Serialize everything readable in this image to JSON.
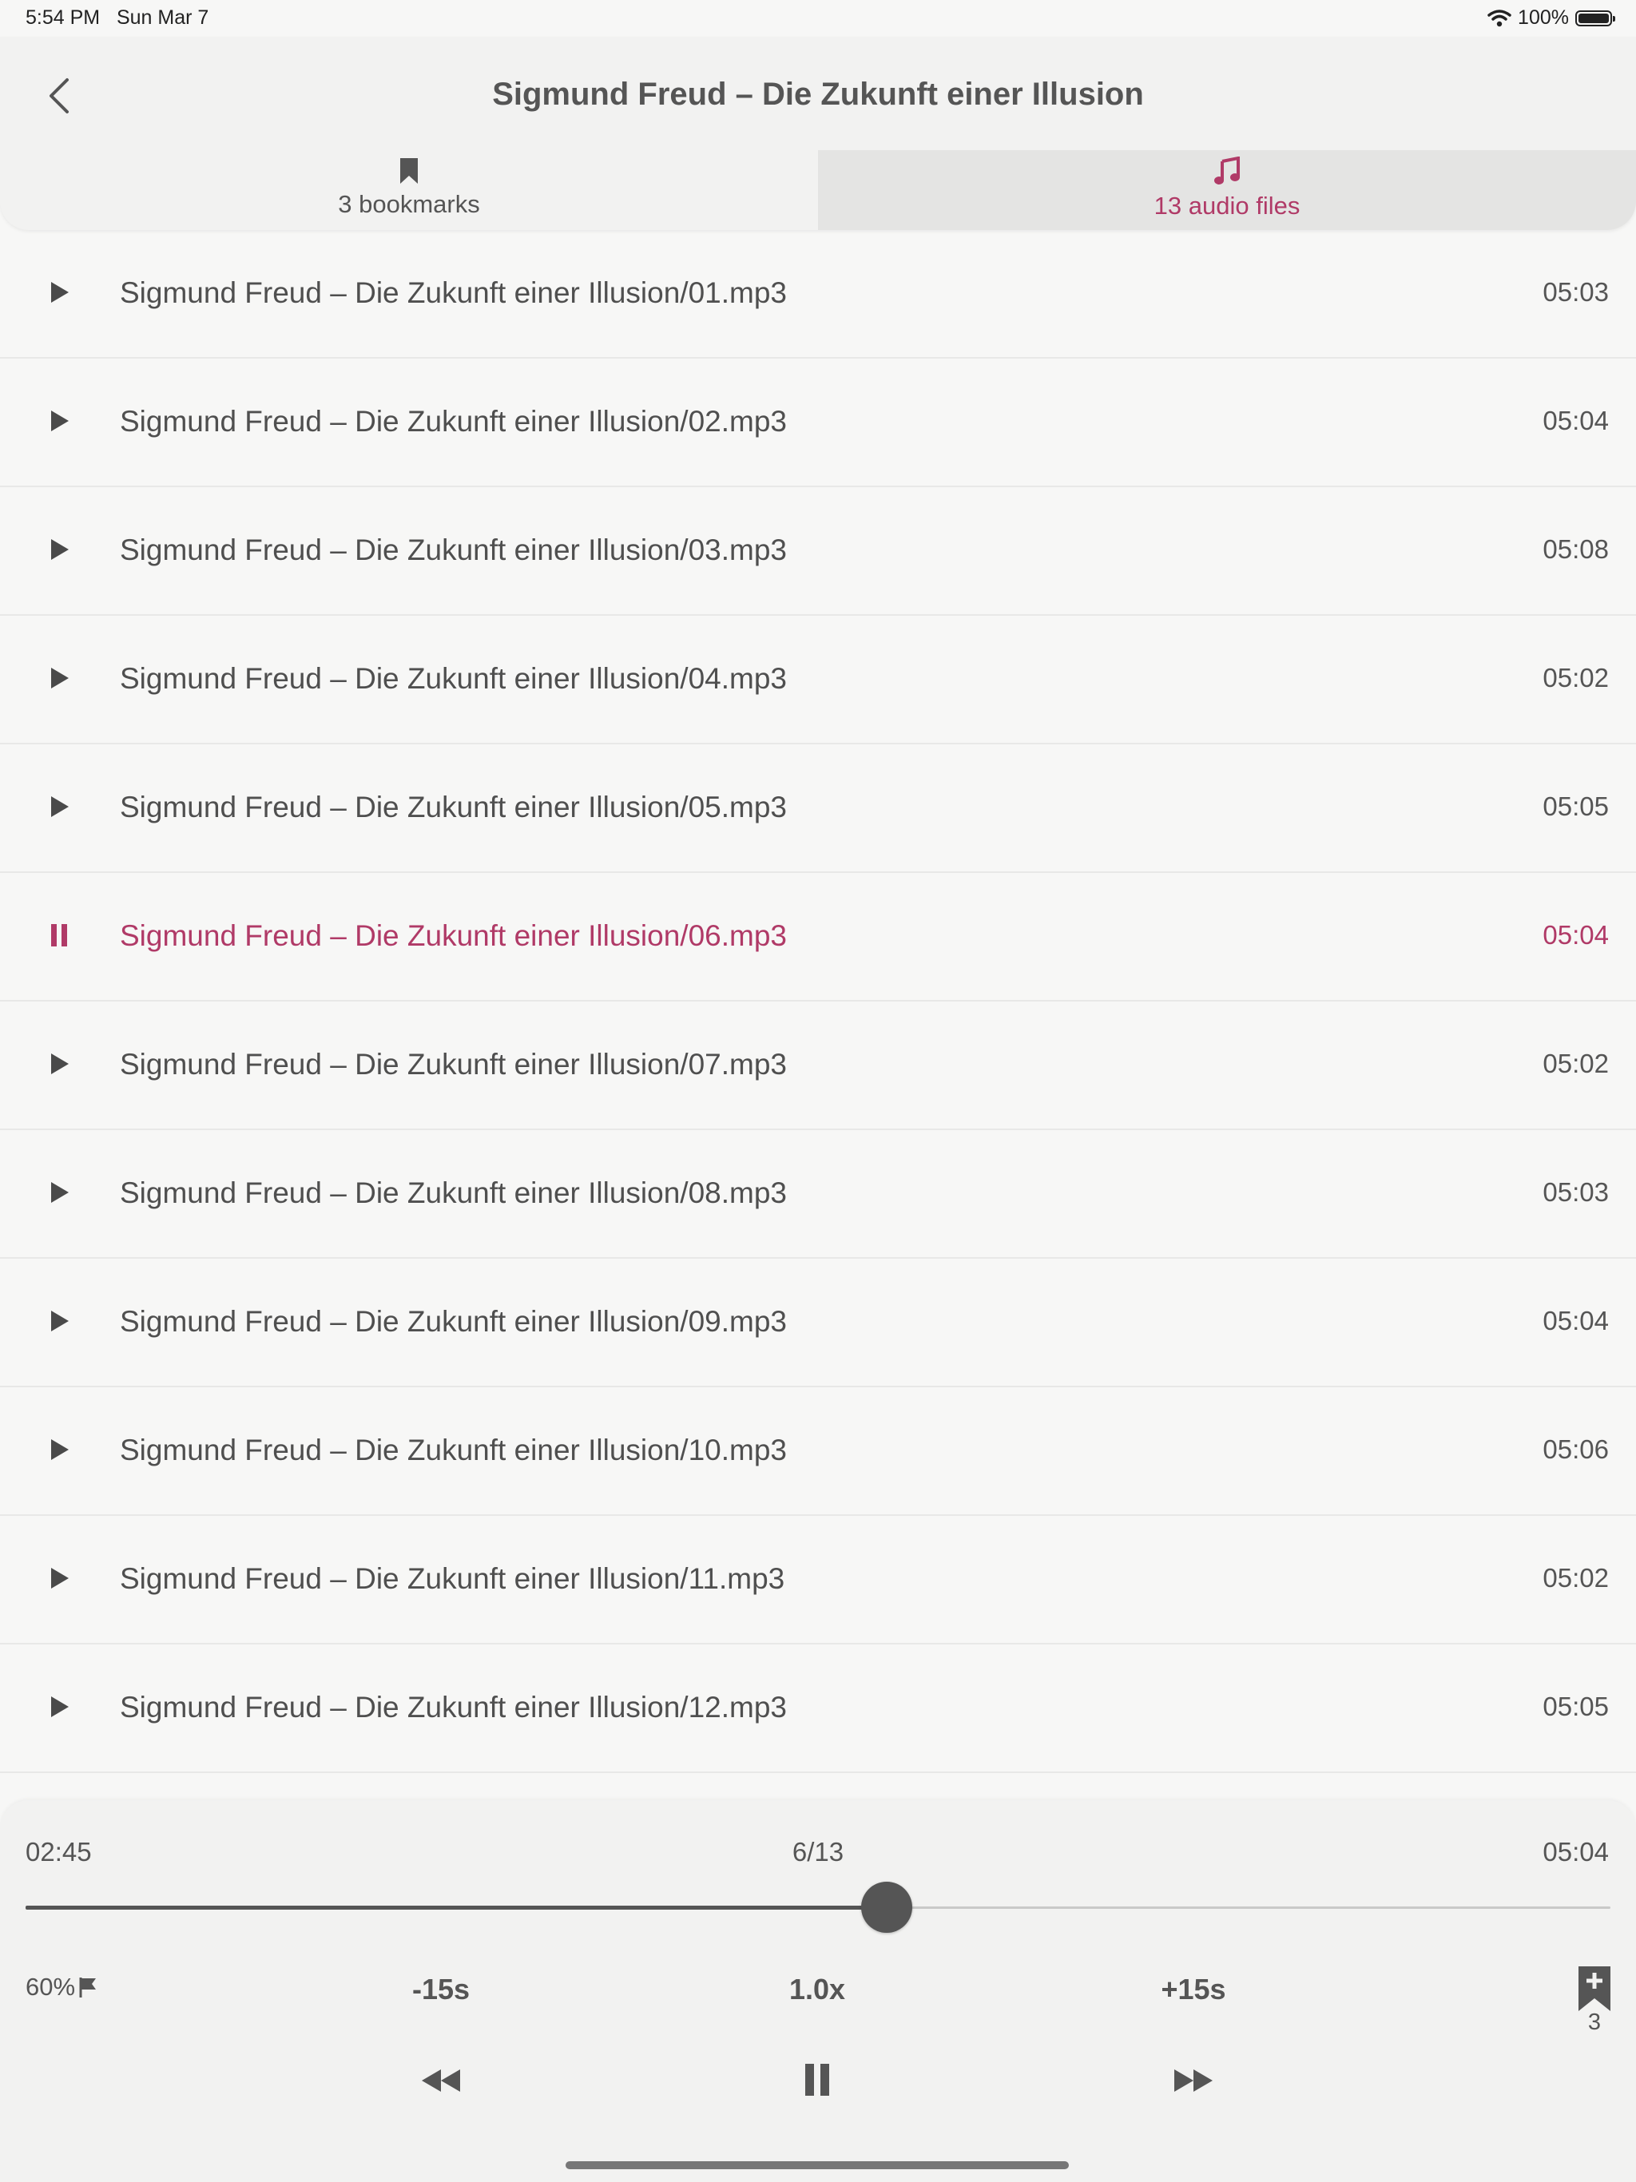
{
  "status_bar": {
    "time": "5:54 PM",
    "date": "Sun Mar 7",
    "battery": "100%"
  },
  "header": {
    "title": "Sigmund Freud – Die Zukunft einer Illusion",
    "back_icon": "chevron-left-icon"
  },
  "tabs": [
    {
      "label": "3 bookmarks",
      "icon": "bookmark-icon",
      "selected": false
    },
    {
      "label": "13 audio files",
      "icon": "music-note-icon",
      "selected": true
    }
  ],
  "tracks": [
    {
      "name": "Sigmund Freud – Die Zukunft einer Illusion/01.mp3",
      "duration": "05:03",
      "playing": false
    },
    {
      "name": "Sigmund Freud – Die Zukunft einer Illusion/02.mp3",
      "duration": "05:04",
      "playing": false
    },
    {
      "name": "Sigmund Freud – Die Zukunft einer Illusion/03.mp3",
      "duration": "05:08",
      "playing": false
    },
    {
      "name": "Sigmund Freud – Die Zukunft einer Illusion/04.mp3",
      "duration": "05:02",
      "playing": false
    },
    {
      "name": "Sigmund Freud – Die Zukunft einer Illusion/05.mp3",
      "duration": "05:05",
      "playing": false
    },
    {
      "name": "Sigmund Freud – Die Zukunft einer Illusion/06.mp3",
      "duration": "05:04",
      "playing": true
    },
    {
      "name": "Sigmund Freud – Die Zukunft einer Illusion/07.mp3",
      "duration": "05:02",
      "playing": false
    },
    {
      "name": "Sigmund Freud – Die Zukunft einer Illusion/08.mp3",
      "duration": "05:03",
      "playing": false
    },
    {
      "name": "Sigmund Freud – Die Zukunft einer Illusion/09.mp3",
      "duration": "05:04",
      "playing": false
    },
    {
      "name": "Sigmund Freud – Die Zukunft einer Illusion/10.mp3",
      "duration": "05:06",
      "playing": false
    },
    {
      "name": "Sigmund Freud – Die Zukunft einer Illusion/11.mp3",
      "duration": "05:02",
      "playing": false
    },
    {
      "name": "Sigmund Freud – Die Zukunft einer Illusion/12.mp3",
      "duration": "05:05",
      "playing": false
    }
  ],
  "player": {
    "elapsed": "02:45",
    "position": "6/13",
    "total": "05:04",
    "progress": 0.5435,
    "volume": "60%",
    "skip_back": "-15s",
    "speed": "1.0x",
    "skip_forward": "+15s",
    "bookmark_count": "3"
  },
  "colors": {
    "accent": "#b03a67",
    "text": "#4f4f4f",
    "background": "#f7f7f6"
  }
}
